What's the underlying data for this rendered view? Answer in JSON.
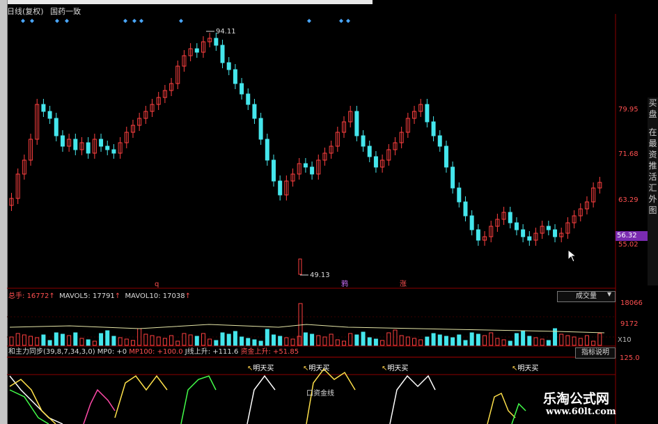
{
  "topbar": {
    "title": "日线(复权)",
    "sector": "国药一致"
  },
  "price_axis": {
    "ticks": [
      "79.95",
      "71.68",
      "63.29",
      "55.02"
    ],
    "current": "56.32"
  },
  "annotations": {
    "high": "94.11",
    "low": "49.13",
    "mid1": "鸦",
    "mid2": "涨",
    "q": "q"
  },
  "volume": {
    "label": "总手:",
    "value": "16772",
    "ma5_label": "MAVOL5:",
    "ma5_value": "17791",
    "ma10_label": "MAVOL10:",
    "ma10_value": "17038",
    "selector": "成交量",
    "ticks": [
      "18066",
      "9172"
    ],
    "unit": "X10"
  },
  "indicator": {
    "name": "和主力同步",
    "params": "(39,8,7,34,3,0)",
    "mp0": "MP0: +0",
    "mp100": "MP100: +100.0",
    "jxian": "J线上升: +111.6",
    "zijin": "资金上升: +51.85",
    "button": "指标说明",
    "tick": "125.0",
    "buy_label": "明天买",
    "bottom_text": "口资金线"
  },
  "right_panel": {
    "chars": [
      "买",
      "盘",
      "在",
      "最",
      "资",
      "推",
      "活",
      "汇",
      "外",
      "图"
    ]
  },
  "watermark": {
    "main": "乐淘公式网",
    "url": "www.60lt.com"
  },
  "colors": {
    "up": "#ff4040",
    "down": "#45e6ec",
    "ma": "#d8d8a0",
    "grid": "#8b0000"
  }
}
